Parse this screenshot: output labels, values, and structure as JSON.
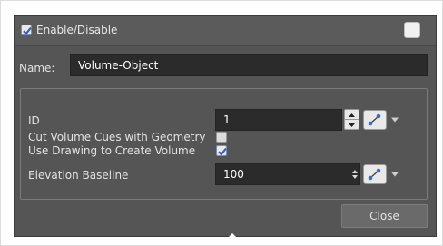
{
  "header": {
    "enable_label": "Enable/Disable",
    "enable_checked": true
  },
  "name_row": {
    "label": "Name:",
    "value": "Volume-Object"
  },
  "params": {
    "id": {
      "label": "ID",
      "value": "1"
    },
    "cut_volume": {
      "label": "Cut Volume Cues with Geometry",
      "checked": false
    },
    "use_drawing": {
      "label": "Use Drawing to Create Volume",
      "checked": true
    },
    "elevation": {
      "label": "Elevation Baseline",
      "value": "100"
    }
  },
  "footer": {
    "close_label": "Close"
  },
  "icons": {
    "link": "link-node-icon",
    "dropdown": "dropdown-arrow-icon",
    "spinner": "spinner-arrows-icon"
  },
  "colors": {
    "panel_bg": "#555555",
    "field_bg": "#2b2b2b",
    "check_mark": "#2f5fb8"
  }
}
